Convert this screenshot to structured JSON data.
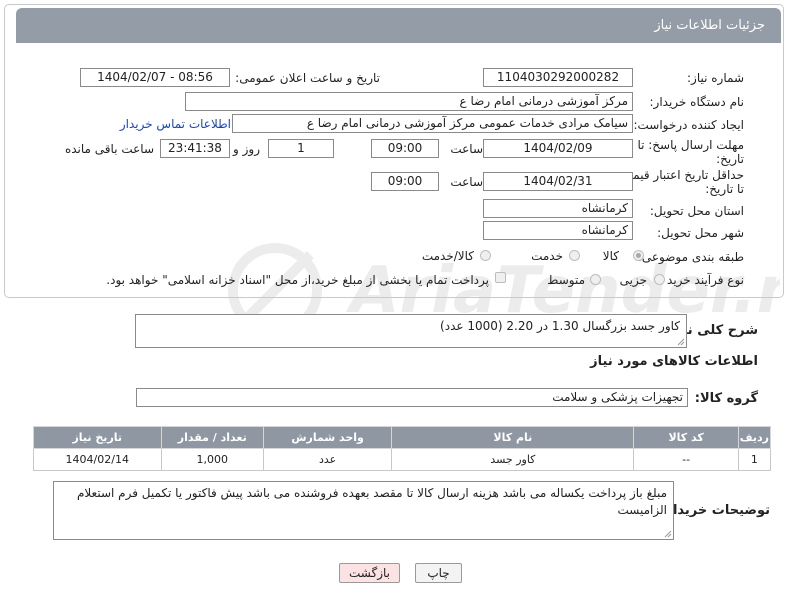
{
  "header": {
    "title": "جزئیات اطلاعات نیاز"
  },
  "fields": {
    "need_number_label": "شماره نیاز:",
    "need_number": "1104030292000282",
    "announce_label": "تاریخ و ساعت اعلان عمومی:",
    "announce_value": "1404/02/07 - 08:56",
    "buyer_org_label": "نام دستگاه خریدار:",
    "buyer_org": "مرکز آموزشی  درمانی امام رضا  ع",
    "creator_label": "ایجاد کننده درخواست:",
    "creator": "سیامک مرادی خدمات عمومی مرکز آموزشی  درمانی امام رضا  ع",
    "contact_link": "اطلاعات تماس خریدار",
    "reply_deadline_label_1": "مهلت ارسال پاسخ: تا",
    "reply_deadline_label_2": "تاریخ:",
    "reply_date": "1404/02/09",
    "time_label": "ساعت",
    "reply_time": "09:00",
    "days_value": "1",
    "days_label": "روز و",
    "remaining_time": "23:41:38",
    "remaining_label": "ساعت باقی مانده",
    "price_validity_label_1": "حداقل تاریخ اعتبار قیمت:",
    "price_validity_label_2": "تا تاریخ:",
    "price_validity_date": "1404/02/31",
    "price_validity_time": "09:00",
    "province_label": "استان محل تحویل:",
    "province": "کرمانشاه",
    "city_label": "شهر محل تحویل:",
    "city": "کرمانشاه",
    "category_label": "طبقه بندی موضوعی:",
    "category_options": [
      "کالا",
      "خدمت",
      "کالا/خدمت"
    ],
    "process_label": "نوع فرآیند خرید :",
    "process_options": [
      "جزیی",
      "متوسط"
    ],
    "payment_note": "پرداخت تمام یا بخشی از مبلغ خرید،از محل \"اسناد خزانه اسلامی\" خواهد بود."
  },
  "description": {
    "label": "شرح کلی نیاز:",
    "text": "کاور جسد بزرگسال 1.30 در 2.20   (1000 عدد)"
  },
  "goods_info_title": "اطلاعات کالاهای مورد نیاز",
  "goods_group": {
    "label": "گروه کالا:",
    "value": "تجهیزات پزشکی و سلامت"
  },
  "table": {
    "headers": [
      "ردیف",
      "کد کالا",
      "نام کالا",
      "واحد شمارش",
      "تعداد / مقدار",
      "تاریخ نیاز"
    ],
    "rows": [
      [
        "1",
        "--",
        "کاور جسد",
        "عدد",
        "1,000",
        "1404/02/14"
      ]
    ]
  },
  "buyer_notes": {
    "label": "توضیحات خریدار:",
    "text": "مبلغ باز پرداخت یکساله می باشد هزینه ارسال کالا تا مقصد بعهده فروشنده می باشد پیش فاکتور یا تکمیل فرم استعلام الزامیست"
  },
  "buttons": {
    "print": "چاپ",
    "back": "بازگشت"
  },
  "watermark": {
    "brand": "AriaTender.neT"
  },
  "colors": {
    "header_bg": "#949da7",
    "table_header_bg": "#8e97a2",
    "link": "#1a47b8"
  }
}
